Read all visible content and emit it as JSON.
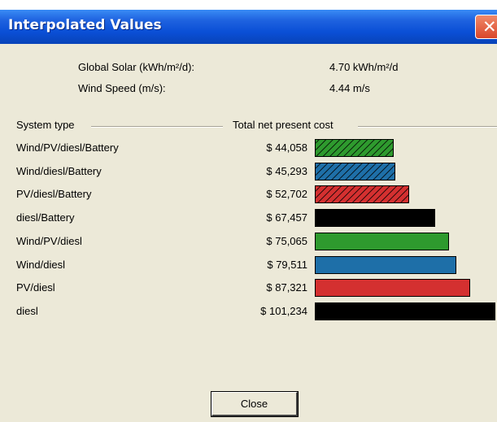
{
  "window": {
    "title": "Interpolated Values",
    "close_glyph": "✕"
  },
  "inputs": [
    {
      "label": "Global Solar (kWh/m²/d):",
      "value": "4.70 kWh/m²/d"
    },
    {
      "label": "Wind Speed (m/s):",
      "value": "4.44 m/s"
    }
  ],
  "table": {
    "col_system": "System type",
    "col_cost": "Total net present cost",
    "rows": [
      {
        "system": "Wind/PV/diesl/Battery",
        "cost": "$ 44,058",
        "value": 44058,
        "color": "#2e9a2e",
        "hatched": true
      },
      {
        "system": "Wind/diesl/Battery",
        "cost": "$ 45,293",
        "value": 45293,
        "color": "#1e6fa8",
        "hatched": true
      },
      {
        "system": "PV/diesl/Battery",
        "cost": "$ 52,702",
        "value": 52702,
        "color": "#d43030",
        "hatched": true
      },
      {
        "system": "diesl/Battery",
        "cost": "$ 67,457",
        "value": 67457,
        "color": "#000000",
        "hatched": true
      },
      {
        "system": "Wind/PV/diesl",
        "cost": "$ 75,065",
        "value": 75065,
        "color": "#2e9a2e",
        "hatched": false
      },
      {
        "system": "Wind/diesl",
        "cost": "$ 79,511",
        "value": 79511,
        "color": "#1e6fa8",
        "hatched": false
      },
      {
        "system": "PV/diesl",
        "cost": "$ 87,321",
        "value": 87321,
        "color": "#d43030",
        "hatched": false
      },
      {
        "system": "diesl",
        "cost": "$ 101,234",
        "value": 101234,
        "color": "#000000",
        "hatched": false
      }
    ]
  },
  "buttons": {
    "close_label": "Close"
  }
}
